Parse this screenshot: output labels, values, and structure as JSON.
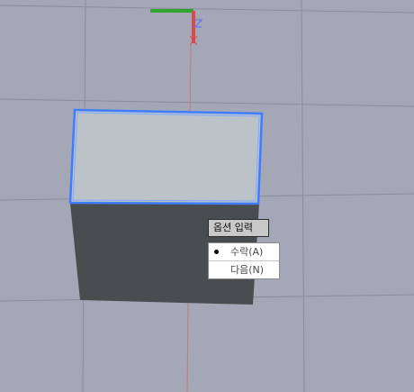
{
  "viewport": {
    "background_color": "#a4a7b6",
    "grid_color": "#8f8c98",
    "box_top_color": "#bcc3c8",
    "box_side_color": "#4a4d4f",
    "selection_color": "#3f7cff",
    "axis_x_color": "#2fa52f",
    "axis_z_color": "#d94a4a"
  },
  "option_prompt": {
    "title": "옵션 입력",
    "options": [
      {
        "label": "수락(A)",
        "selected": true
      },
      {
        "label": "다음(N)",
        "selected": false
      }
    ]
  }
}
